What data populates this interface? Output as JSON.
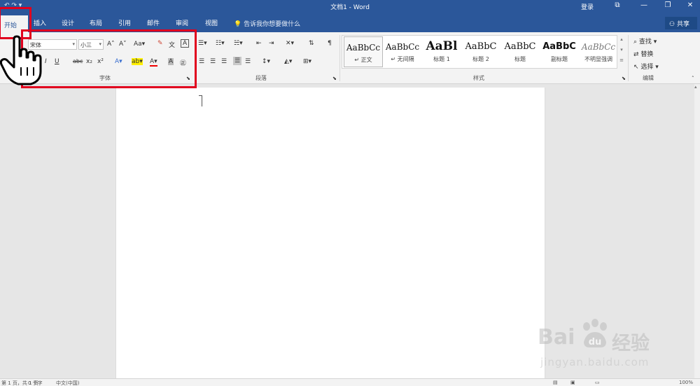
{
  "titlebar": {
    "title": "文档1 - Word",
    "qat": "↶ ↷ ▾",
    "signin": "登录",
    "buttons": [
      "⧉",
      "—",
      "❐",
      "✕"
    ]
  },
  "tabs": {
    "active": "开始",
    "items": [
      "插入",
      "设计",
      "布局",
      "引用",
      "邮件",
      "审阅",
      "视图"
    ],
    "tell_me": "告诉我你想要做什么",
    "share": "共享"
  },
  "font_group": {
    "font_name": "宋体",
    "font_size": "小三",
    "grow": "A˄",
    "shrink": "A˅",
    "change_case": "Aa▾",
    "italic": "I",
    "underline": "U",
    "strike": "abc",
    "subscript": "x₂",
    "superscript": "x²",
    "text_effects": "A▾",
    "highlight": "ab▾",
    "font_color": "A▾",
    "char_shading": "A",
    "enclose": "㊣",
    "label": "字体"
  },
  "paragraph_group": {
    "label": "段落"
  },
  "styles_group": {
    "label": "样式",
    "items": [
      {
        "sample": "AaBbCc",
        "name": "↵ 正文"
      },
      {
        "sample": "AaBbCc",
        "name": "↵ 无间隔"
      },
      {
        "sample": "AaBl",
        "name": "标题 1"
      },
      {
        "sample": "AaBbC",
        "name": "标题 2"
      },
      {
        "sample": "AaBbC",
        "name": "标题"
      },
      {
        "sample": "AaBbC",
        "name": "副标题"
      },
      {
        "sample": "AaBbCc",
        "name": "不明显强调"
      }
    ]
  },
  "editing_group": {
    "label": "编辑",
    "find": "查找 ▾",
    "replace": "替换",
    "select": "选择 ▾"
  },
  "statusbar": {
    "page": "第 1 页，共 1 页",
    "words": "0 个字",
    "language": "中文(中国)",
    "zoom": "100%"
  },
  "watermark": {
    "brand": "Bai",
    "brand_cn": "经验",
    "url": "jingyan.baidu.com"
  },
  "colors": {
    "word_blue": "#2b579a",
    "highlight_red": "#e1001e",
    "ribbon_bg": "#f3f3f3"
  }
}
